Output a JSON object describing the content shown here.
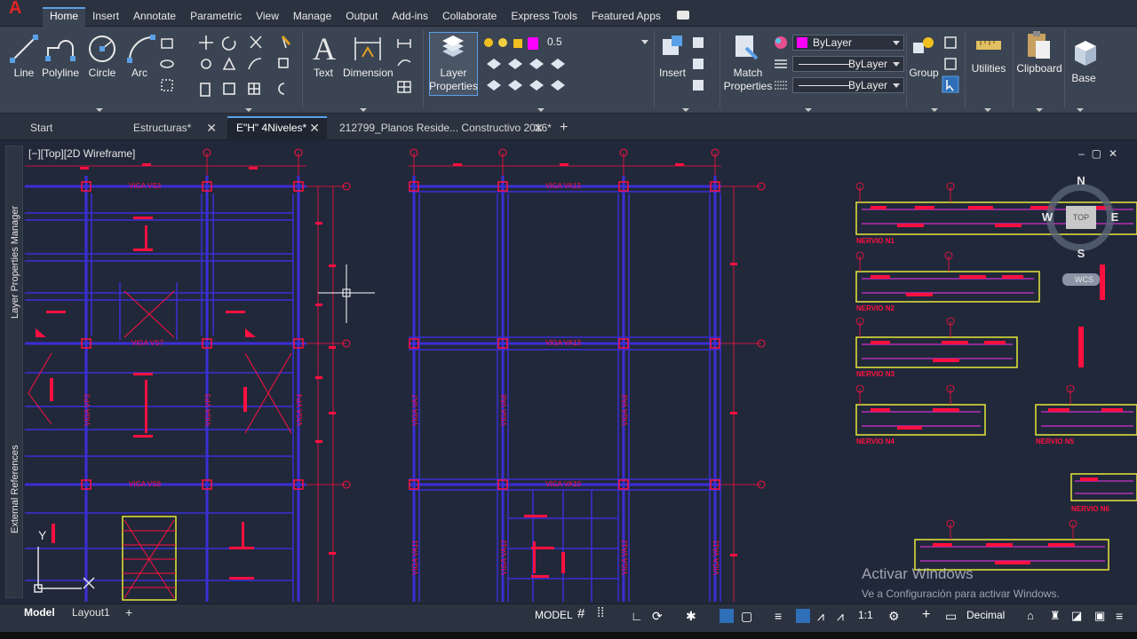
{
  "app": {
    "logo": "A"
  },
  "menu": {
    "tabs": [
      "Home",
      "Insert",
      "Annotate",
      "Parametric",
      "View",
      "Manage",
      "Output",
      "Add-ins",
      "Collaborate",
      "Express Tools",
      "Featured Apps"
    ]
  },
  "ribbon": {
    "draw": {
      "line": "Line",
      "polyline": "Polyline",
      "circle": "Circle",
      "arc": "Arc"
    },
    "annotation": {
      "text": "Text",
      "dimension": "Dimension"
    },
    "layers": {
      "layer_properties_1": "Layer",
      "layer_properties_2": "Properties",
      "lineweight_value": "0.5"
    },
    "block": {
      "insert": "Insert"
    },
    "properties": {
      "match_1": "Match",
      "match_2": "Properties",
      "color": "ByLayer",
      "linetype": "ByLayer",
      "lineweight": "ByLayer"
    },
    "groups": {
      "group": "Group"
    },
    "utilities": "Utilities",
    "clipboard": "Clipboard",
    "view": {
      "base": "Base"
    }
  },
  "doc_tabs": [
    {
      "label": "Start",
      "closable": false
    },
    {
      "label": "Estructuras*",
      "closable": true
    },
    {
      "label": "E\"H\" 4Niveles*",
      "closable": true,
      "active": true
    },
    {
      "label": "212799_Planos Reside... Constructivo 2016*",
      "closable": true
    }
  ],
  "workspace": {
    "viewport_label": "[−][Top][2D Wireframe]",
    "side_palettes": [
      "Layer Properties Manager",
      "External References"
    ],
    "viewcube": {
      "n": "N",
      "s": "S",
      "e": "E",
      "w": "W",
      "top": "TOP",
      "wcs": "WCS"
    },
    "ucs": {
      "y": "Y",
      "x": "X"
    },
    "drawing_labels": {
      "beams_left": [
        "VIGA VS3",
        "VIGA VS7",
        "VIGA VS8"
      ],
      "beams_right": [
        "VIGA VA13",
        "VIGA VA13",
        "VIGA VA10"
      ],
      "verticals_left": [
        "VIGA VP2",
        "VIGA VP3",
        "VIGA VP4"
      ],
      "verticals_right": [
        "VIGA VA7",
        "VIGA VA8",
        "VIGA VA9"
      ],
      "verticals_bottom": [
        "VIGA VA11",
        "VIGA VA12",
        "VIGA VA12",
        "VIGA VA11"
      ],
      "nervios": [
        "NERVIO N1",
        "NERVIO N2",
        "NERVIO N3",
        "NERVIO N4",
        "NERVIO N5",
        "NERVIO N6"
      ]
    },
    "watermark": {
      "title": "Activar Windows",
      "subtitle": "Ve a Configuración para activar Windows."
    }
  },
  "status": {
    "layout_tabs": [
      "Model",
      "Layout1"
    ],
    "model": "MODEL",
    "scale": "1:1",
    "units": "Decimal"
  },
  "colors": {
    "beam_blue": "#3a2fd6",
    "annot_red": "#ff1040",
    "highlight_yellow": "#e8e83a",
    "magenta": "#d030d0"
  }
}
